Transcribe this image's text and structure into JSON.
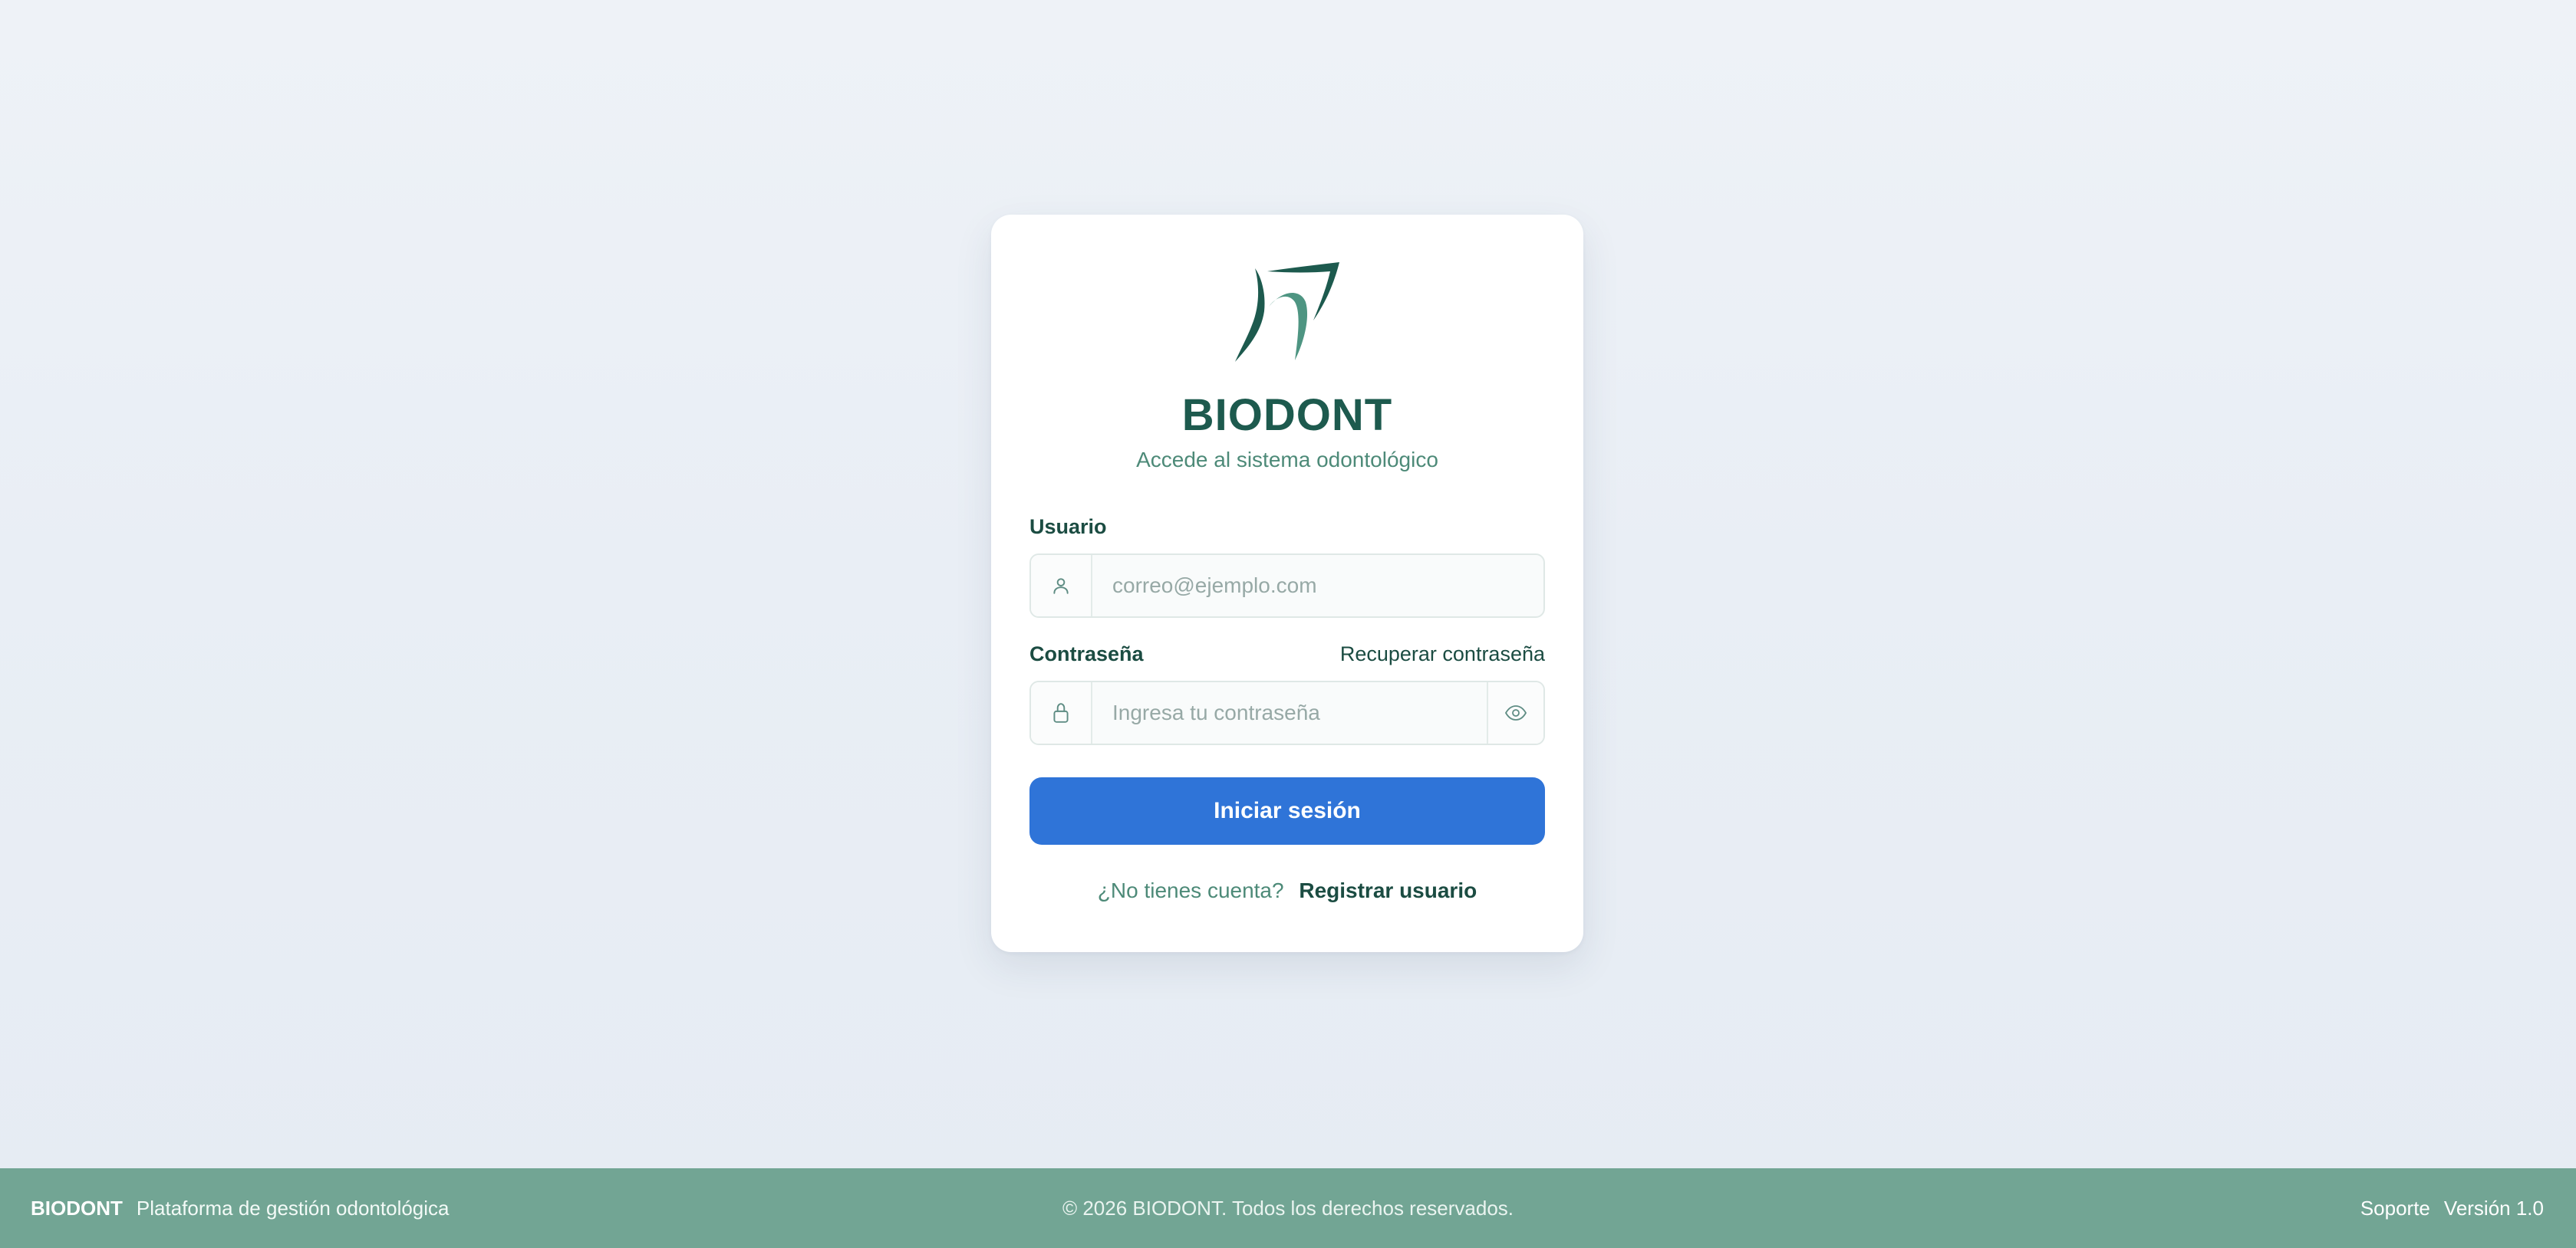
{
  "brand": {
    "name": "BIODONT",
    "subtitle": "Accede al sistema odontológico",
    "logo_icon": "tooth-icon",
    "colors": {
      "primary_dark": "#1d5a4e",
      "accent_green": "#4d8a78",
      "button_blue": "#2f74d8",
      "footer_green": "#72a594"
    }
  },
  "form": {
    "username": {
      "label": "Usuario",
      "icon": "user-icon",
      "value": "",
      "placeholder": "correo@ejemplo.com"
    },
    "password": {
      "label": "Contraseña",
      "icon": "lock-icon",
      "toggle_icon": "eye-icon",
      "value": "",
      "placeholder": "Ingresa tu contraseña",
      "recover_link": "Recuperar contraseña"
    },
    "submit_label": "Iniciar sesión",
    "register": {
      "question": "¿No tienes cuenta?",
      "link": "Registrar usuario"
    }
  },
  "footer": {
    "brand": "BIODONT",
    "tagline": "Plataforma de gestión odontológica",
    "copyright": "© 2026 BIODONT. Todos los derechos reservados.",
    "support": "Soporte",
    "version": "Versión 1.0"
  }
}
